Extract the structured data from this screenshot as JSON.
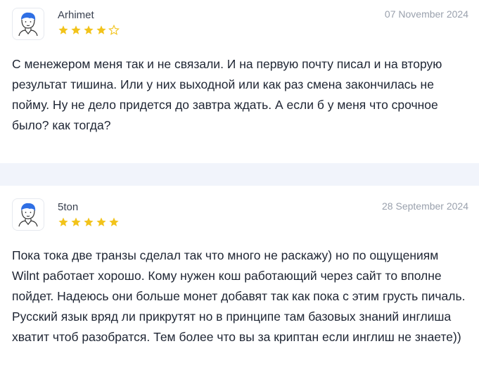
{
  "reviews": [
    {
      "author": "Arhimet",
      "date": "07 November 2024",
      "rating": 4,
      "rating_max": 5,
      "text": "С менежером меня так и не связали. И на первую почту писал и на вторую результат тишина. Или у них выходной или как раз смена закончилась не пойму. Ну не дело придется до завтра ждать. А если б у меня что срочное было? как тогда?",
      "avatar_icon": "user-avatar-icon"
    },
    {
      "author": "5ton",
      "date": "28 September 2024",
      "rating": 5,
      "rating_max": 5,
      "text": "Пока тока две транзы сделал так что много не раскажу) но по ощущениям Wilnt работает хорошо. Кому нужен кош работающий через сайт то вполне пойдет. Надеюсь они больше монет добавят так как пока с этим грусть пичаль. Русский язык вряд ли прикрутят но в принципе там базовых знаний инглиша хватит чтоб разобратся. Тем более что вы за криптан если инглиш не знаете))",
      "avatar_icon": "user-avatar-icon"
    }
  ],
  "colors": {
    "star_filled": "#f2c31a",
    "star_empty_stroke": "#f2c31a",
    "separator": "#f1f4fb",
    "avatar_hair": "#2f6fe4"
  }
}
